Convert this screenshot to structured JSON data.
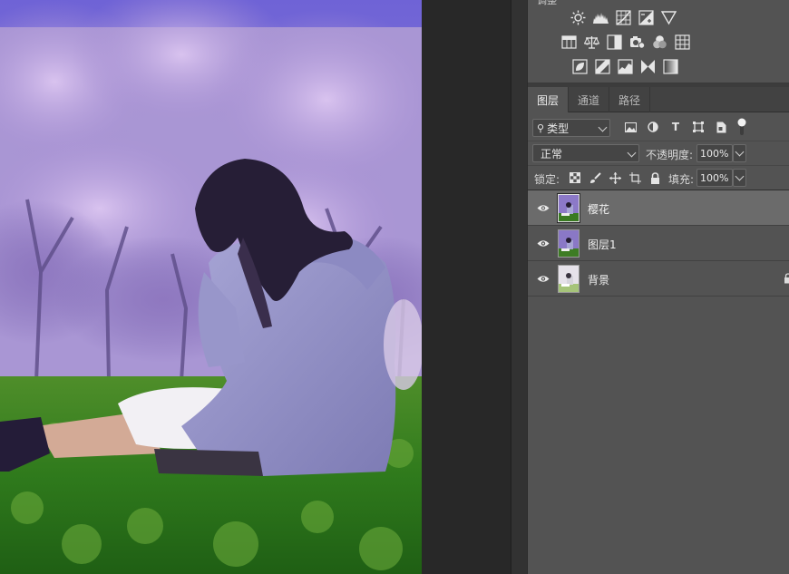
{
  "adjustments": {
    "title_fragment": "调整",
    "row1": [
      "brightness-contrast-icon",
      "levels-icon",
      "curves-icon",
      "exposure-icon",
      "vibrance-icon"
    ],
    "row2": [
      "hue-saturation-icon",
      "color-balance-icon",
      "black-white-icon",
      "photo-filter-icon",
      "channel-mixer-icon",
      "color-lookup-icon"
    ],
    "row3": [
      "invert-icon",
      "posterize-icon",
      "threshold-icon",
      "selective-color-icon",
      "gradient-map-icon"
    ]
  },
  "tabs": [
    {
      "label": "图层",
      "active": true
    },
    {
      "label": "通道",
      "active": false
    },
    {
      "label": "路径",
      "active": false
    }
  ],
  "filter": {
    "kind_label": "类型",
    "icons": [
      "image-filter-icon",
      "adjustment-filter-icon",
      "type-filter-icon",
      "shape-filter-icon",
      "smart-object-filter-icon"
    ]
  },
  "blend": {
    "mode": "正常",
    "opacity_label": "不透明度:",
    "opacity_value": "100%"
  },
  "lock": {
    "label": "锁定:",
    "icons": [
      "lock-transparent-icon",
      "lock-image-icon",
      "lock-position-icon",
      "lock-artboard-icon",
      "lock-all-icon"
    ],
    "fill_label": "填充:",
    "fill_value": "100%"
  },
  "layers": [
    {
      "name": "樱花",
      "selected": true,
      "locked": false
    },
    {
      "name": "图层1",
      "selected": false,
      "locked": false
    },
    {
      "name": "背景",
      "selected": false,
      "locked": true
    }
  ],
  "colors": {
    "panel_bg": "#535353",
    "selected_layer": "#6b6b6b",
    "pasteboard": "#282828"
  }
}
